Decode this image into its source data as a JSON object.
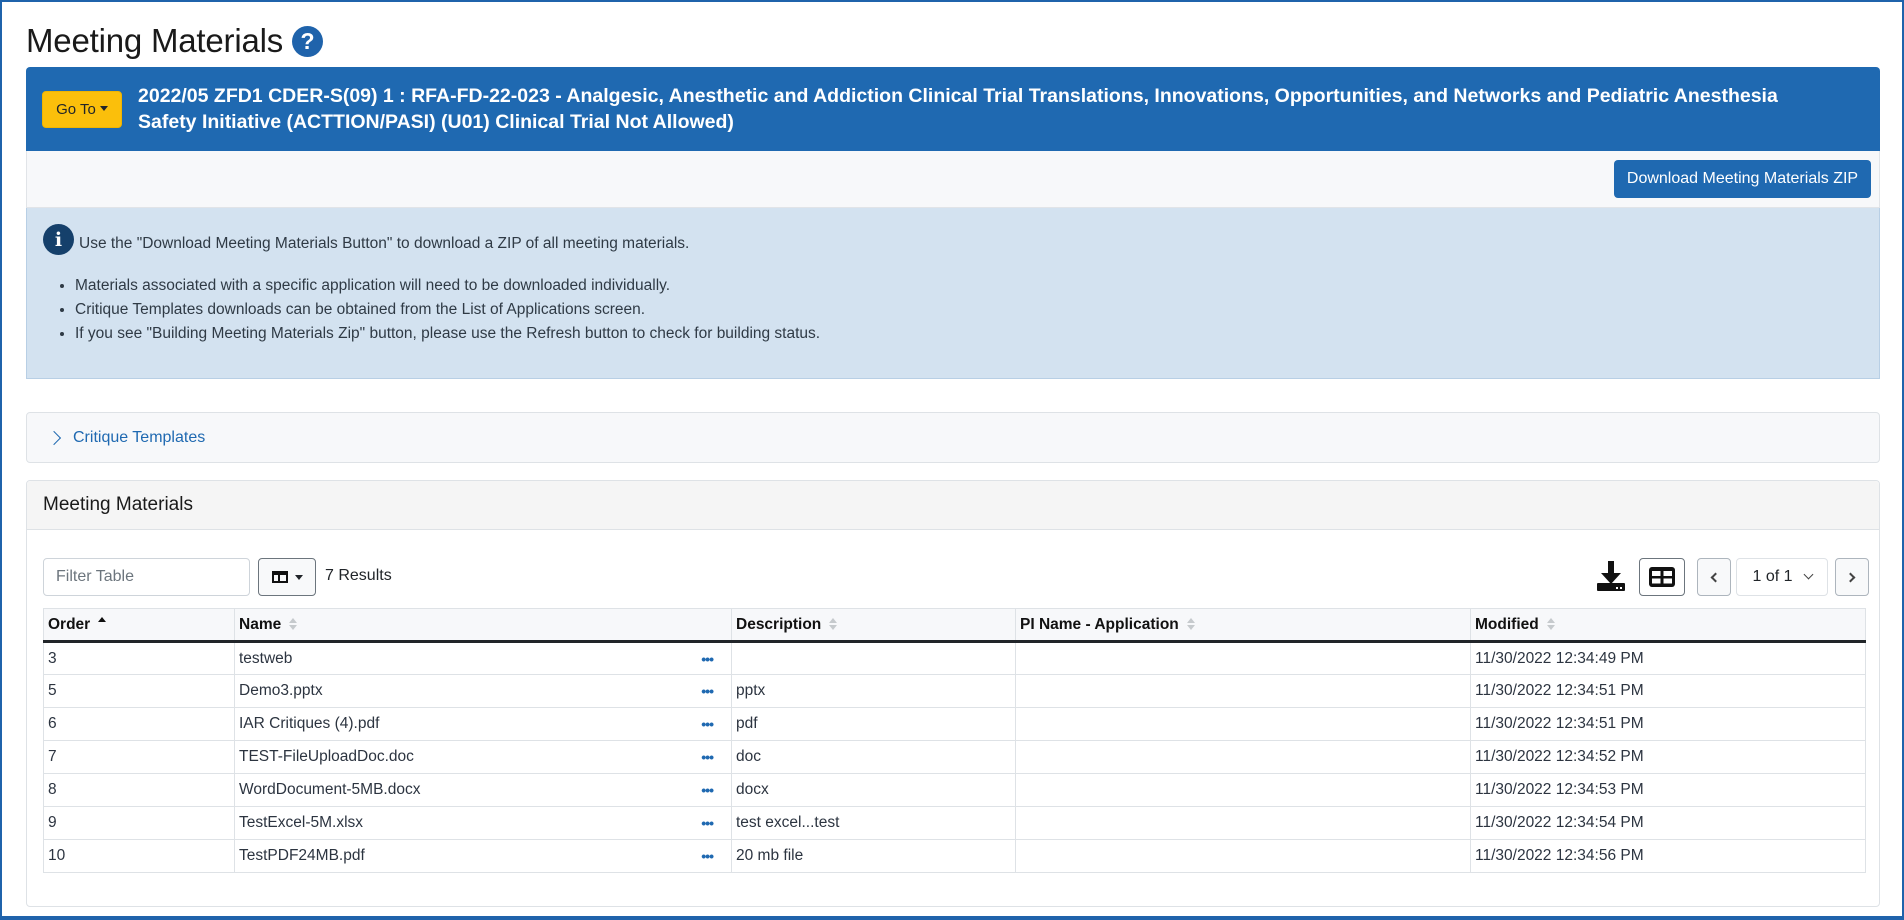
{
  "page": {
    "title": "Meeting Materials",
    "help_icon": "question-circle-icon"
  },
  "meeting": {
    "goto_label": "Go To",
    "title": "2022/05 ZFD1 CDER-S(09) 1 : RFA-FD-22-023 - Analgesic, Anesthetic and Addiction Clinical Trial Translations, Innovations, Opportunities, and Networks and Pediatric Anesthesia Safety Initiative (ACTTION/PASI) (U01) Clinical Trial Not Allowed)"
  },
  "actions": {
    "download_zip_label": "Download Meeting Materials ZIP"
  },
  "info": {
    "icon": "info-circle-icon",
    "lead": "Use the \"Download Meeting Materials Button\" to download a ZIP of all meeting materials.",
    "bullets": [
      "Materials associated with a specific application will need to be downloaded individually.",
      "Critique Templates downloads can be obtained from the List of Applications screen.",
      "If you see \"Building Meeting Materials Zip\" button, please use the Refresh button to check for building status."
    ]
  },
  "critique_templates": {
    "label": "Critique Templates",
    "expanded": false
  },
  "materials": {
    "card_title": "Meeting Materials",
    "filter_placeholder": "Filter Table",
    "filter_value": "",
    "results_text": "7 Results",
    "pagination": {
      "current": "1 of 1"
    },
    "columns": [
      {
        "label": "Order",
        "sort": "asc"
      },
      {
        "label": "Name",
        "sort": "none"
      },
      {
        "label": "Description",
        "sort": "none"
      },
      {
        "label": "PI Name - Application",
        "sort": "none"
      },
      {
        "label": "Modified",
        "sort": "none"
      }
    ],
    "rows": [
      {
        "order": "3",
        "name": "testweb",
        "description": "",
        "pi": "",
        "modified": "11/30/2022 12:34:49 PM"
      },
      {
        "order": "5",
        "name": "Demo3.pptx",
        "description": "pptx",
        "pi": "",
        "modified": "11/30/2022 12:34:51 PM"
      },
      {
        "order": "6",
        "name": "IAR Critiques (4).pdf",
        "description": "pdf",
        "pi": "",
        "modified": "11/30/2022 12:34:51 PM"
      },
      {
        "order": "7",
        "name": "TEST-FileUploadDoc.doc",
        "description": "doc",
        "pi": "",
        "modified": "11/30/2022 12:34:52 PM"
      },
      {
        "order": "8",
        "name": "WordDocument-5MB.docx",
        "description": "docx",
        "pi": "",
        "modified": "11/30/2022 12:34:53 PM"
      },
      {
        "order": "9",
        "name": "TestExcel-5M.xlsx",
        "description": "test excel...test",
        "pi": "",
        "modified": "11/30/2022 12:34:54 PM"
      },
      {
        "order": "10",
        "name": "TestPDF24MB.pdf",
        "description": "20 mb file",
        "pi": "",
        "modified": "11/30/2022 12:34:56 PM"
      }
    ]
  },
  "colors": {
    "brand_blue": "#1f69b1",
    "goto_yellow": "#fbbf0b",
    "info_bg": "#d3e2f0",
    "info_icon": "#15406b"
  }
}
